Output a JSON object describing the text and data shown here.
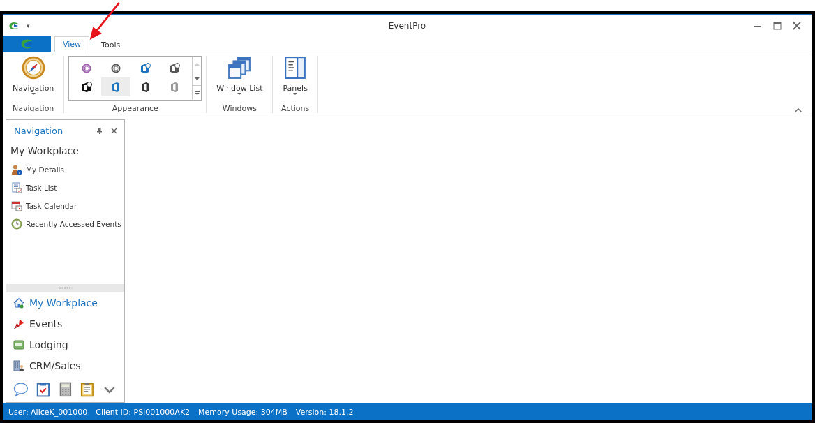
{
  "window": {
    "title": "EventPro",
    "quick_access": "▾"
  },
  "tabs": [
    {
      "label": "View",
      "selected": true
    },
    {
      "label": "Tools",
      "selected": false
    }
  ],
  "ribbon": {
    "groups": [
      {
        "kind": "large",
        "label": "Navigation",
        "buttons": [
          {
            "label": "Navigation"
          }
        ]
      },
      {
        "kind": "gallery",
        "label": "Appearance",
        "items": [
          {
            "kind": "round",
            "color": "#a066b0",
            "selected": false
          },
          {
            "kind": "round",
            "color": "#555555",
            "selected": false
          },
          {
            "kind": "badge",
            "color": "#1e73be",
            "selected": false
          },
          {
            "kind": "badge",
            "color": "#555555",
            "selected": false
          },
          {
            "kind": "badge",
            "color": "#111111",
            "selected": false
          },
          {
            "kind": "office",
            "color": "#1e73be",
            "selected": true
          },
          {
            "kind": "office",
            "color": "#333333",
            "selected": false
          },
          {
            "kind": "office",
            "color": "#999999",
            "selected": false
          }
        ]
      },
      {
        "kind": "large",
        "label": "Windows",
        "buttons": [
          {
            "label": "Window List"
          }
        ]
      },
      {
        "kind": "large",
        "label": "Actions",
        "buttons": [
          {
            "label": "Panels"
          }
        ]
      }
    ]
  },
  "navigation_panel": {
    "title": "Navigation",
    "section_title": "My Workplace",
    "links": [
      {
        "label": "My Details"
      },
      {
        "label": "Task List"
      },
      {
        "label": "Task Calendar"
      },
      {
        "label": "Recently Accessed Events"
      }
    ],
    "groups": [
      {
        "label": "My Workplace",
        "selected": true
      },
      {
        "label": "Events",
        "selected": false
      },
      {
        "label": "Lodging",
        "selected": false
      },
      {
        "label": "CRM/Sales",
        "selected": false
      }
    ]
  },
  "status_bar": [
    "User: AliceK_001000",
    "Client ID: PSI001000AK2",
    "Memory Usage: 304MB",
    "Version: 18.1.2"
  ]
}
